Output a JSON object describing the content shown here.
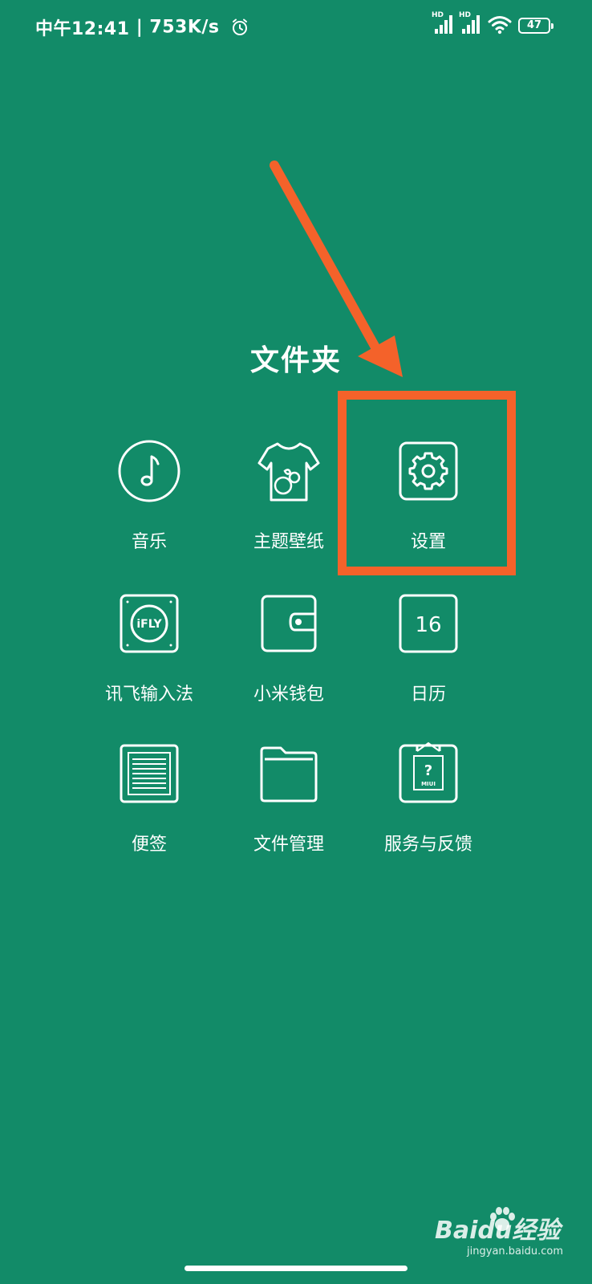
{
  "status_bar": {
    "time": "中午12:41",
    "separator": "|",
    "net_speed": "753K/s",
    "signal_1_label": "HD",
    "signal_2_label": "HD",
    "battery": "47"
  },
  "folder": {
    "title": "文件夹",
    "apps": [
      {
        "label": "音乐",
        "icon": "music-note-icon"
      },
      {
        "label": "主题壁纸",
        "icon": "theme-shirt-icon"
      },
      {
        "label": "设置",
        "icon": "gear-icon"
      },
      {
        "label": "讯飞输入法",
        "icon": "ifly-icon",
        "icon_text": "iFLY"
      },
      {
        "label": "小米钱包",
        "icon": "wallet-icon"
      },
      {
        "label": "日历",
        "icon": "calendar-icon",
        "icon_text": "16"
      },
      {
        "label": "便签",
        "icon": "notes-icon"
      },
      {
        "label": "文件管理",
        "icon": "folder-icon"
      },
      {
        "label": "服务与反馈",
        "icon": "service-feedback-icon",
        "icon_text": "?",
        "icon_subtext": "MIUI"
      }
    ]
  },
  "annotation": {
    "color": "#f4622a"
  },
  "watermark": {
    "brand": "Baidu经验",
    "url": "jingyan.baidu.com"
  },
  "colors": {
    "background": "#128b68",
    "foreground": "#ffffff"
  }
}
